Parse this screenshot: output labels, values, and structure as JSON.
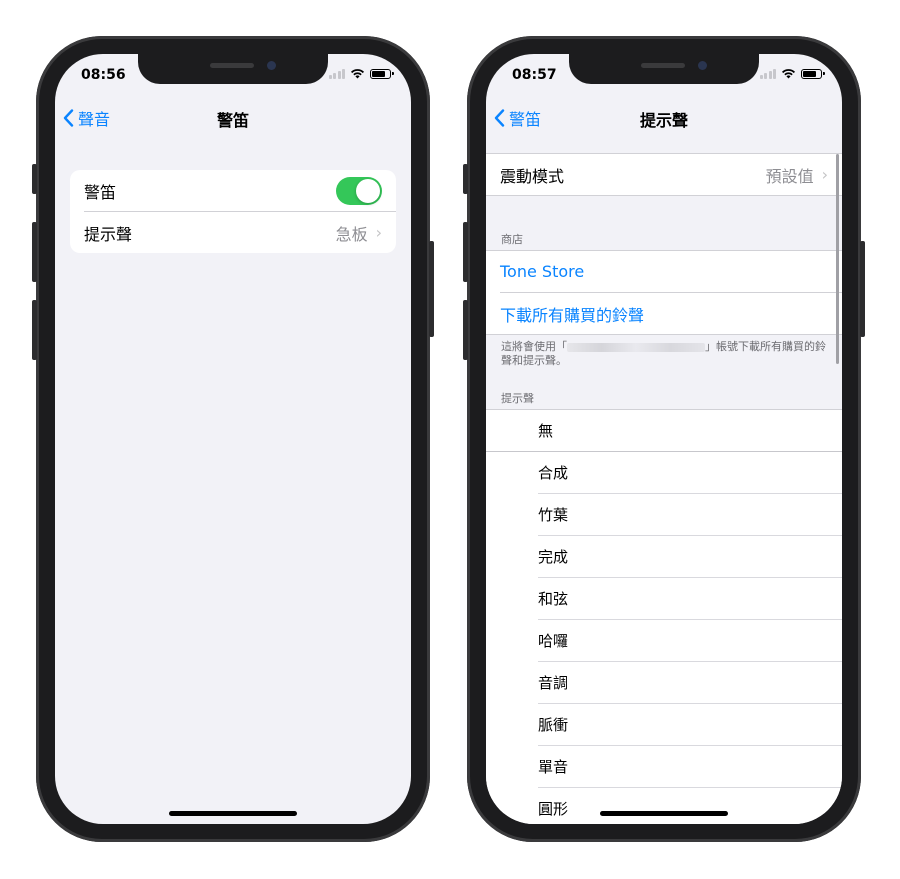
{
  "left": {
    "status": {
      "time": "08:56"
    },
    "nav": {
      "back": "聲音",
      "title": "警笛"
    },
    "rows": [
      {
        "label": "警笛",
        "type": "toggle",
        "on": true
      },
      {
        "label": "提示聲",
        "value": "急板"
      }
    ]
  },
  "right": {
    "status": {
      "time": "08:57"
    },
    "nav": {
      "back": "警笛",
      "title": "提示聲"
    },
    "vibration": {
      "label": "震動模式",
      "value": "預設值"
    },
    "store": {
      "header": "商店",
      "tone_store": "Tone Store",
      "download_all": "下載所有購買的鈴聲",
      "footer_before": "這將會使用「",
      "footer_after": "」帳號下載所有購買的鈴聲和提示聲。"
    },
    "tones": {
      "header": "提示聲",
      "items": [
        "無",
        "合成",
        "竹葉",
        "完成",
        "和弦",
        "哈囉",
        "音調",
        "脈衝",
        "單音",
        "圓形"
      ]
    }
  },
  "colors": {
    "accent": "#0a84ff",
    "toggle_on": "#34c759",
    "background": "#f2f2f7"
  }
}
